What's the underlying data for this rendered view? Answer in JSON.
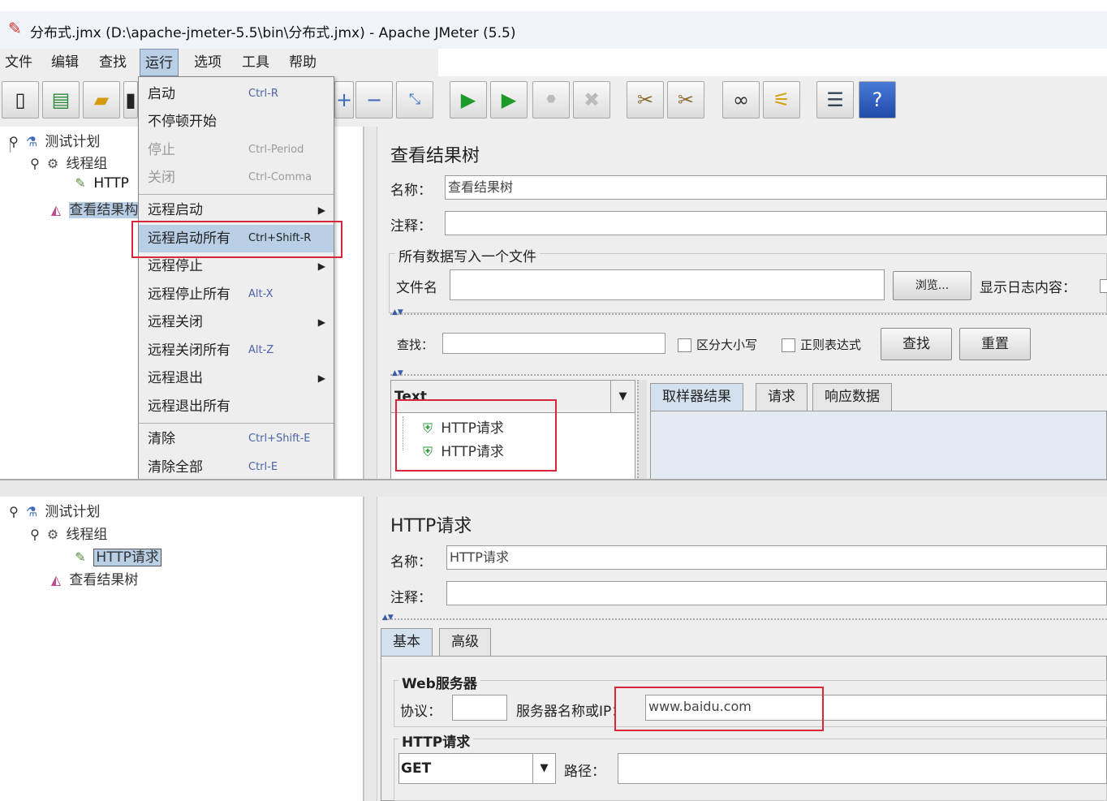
{
  "window": {
    "title": "分布式.jmx (D:\\apache-jmeter-5.5\\bin\\分布式.jmx) - Apache JMeter (5.5)"
  },
  "menubar": [
    "文件",
    "编辑",
    "查找",
    "运行",
    "选项",
    "工具",
    "帮助"
  ],
  "run_menu": [
    {
      "label": "启动",
      "shortcut": "Ctrl-R"
    },
    {
      "label": "不停顿开始",
      "shortcut": ""
    },
    {
      "label": "停止",
      "shortcut": "Ctrl-Period"
    },
    {
      "label": "关闭",
      "shortcut": "Ctrl-Comma"
    },
    {
      "label": "远程启动",
      "shortcut": ""
    },
    {
      "label": "远程启动所有",
      "shortcut": "Ctrl+Shift-R"
    },
    {
      "label": "远程停止",
      "shortcut": ""
    },
    {
      "label": "远程停止所有",
      "shortcut": "Alt-X"
    },
    {
      "label": "远程关闭",
      "shortcut": ""
    },
    {
      "label": "远程关闭所有",
      "shortcut": "Alt-Z"
    },
    {
      "label": "远程退出",
      "shortcut": ""
    },
    {
      "label": "远程退出所有",
      "shortcut": ""
    },
    {
      "label": "清除",
      "shortcut": "Ctrl+Shift-E"
    },
    {
      "label": "清除全部",
      "shortcut": "Ctrl-E"
    }
  ],
  "tree_top": {
    "test_plan": "测试计划",
    "thread_group": "线程组",
    "http_partial": "HTTP",
    "result_tree_partial": "查看结果构"
  },
  "result_tree": {
    "title": "查看结果树",
    "name_label": "名称：",
    "name_value": "查看结果树",
    "comment_label": "注释：",
    "write_all_label": "所有数据写入一个文件",
    "filename_label": "文件名",
    "browse_button": "浏览...",
    "show_log_label": "显示日志内容：",
    "search_label": "查找：",
    "case_sensitive": "区分大小写",
    "regex": "正则表达式",
    "find_button": "查找",
    "reset_button": "重置",
    "renderer": "Text",
    "results": [
      "HTTP请求",
      "HTTP请求"
    ],
    "tabs": [
      "取样器结果",
      "请求",
      "响应数据"
    ]
  },
  "tree_bottom": {
    "test_plan": "测试计划",
    "thread_group": "线程组",
    "http_request": "HTTP请求",
    "result_tree": "查看结果树"
  },
  "http_request": {
    "title": "HTTP请求",
    "name_label": "名称：",
    "name_value": "HTTP请求",
    "comment_label": "注释：",
    "tabs": [
      "基本",
      "高级"
    ],
    "web_server_label": "Web服务器",
    "protocol_label": "协议：",
    "server_label": "服务器名称或IP：",
    "server_value": "www.baidu.com",
    "http_request_label": "HTTP请求",
    "method": "GET",
    "path_label": "路径："
  }
}
